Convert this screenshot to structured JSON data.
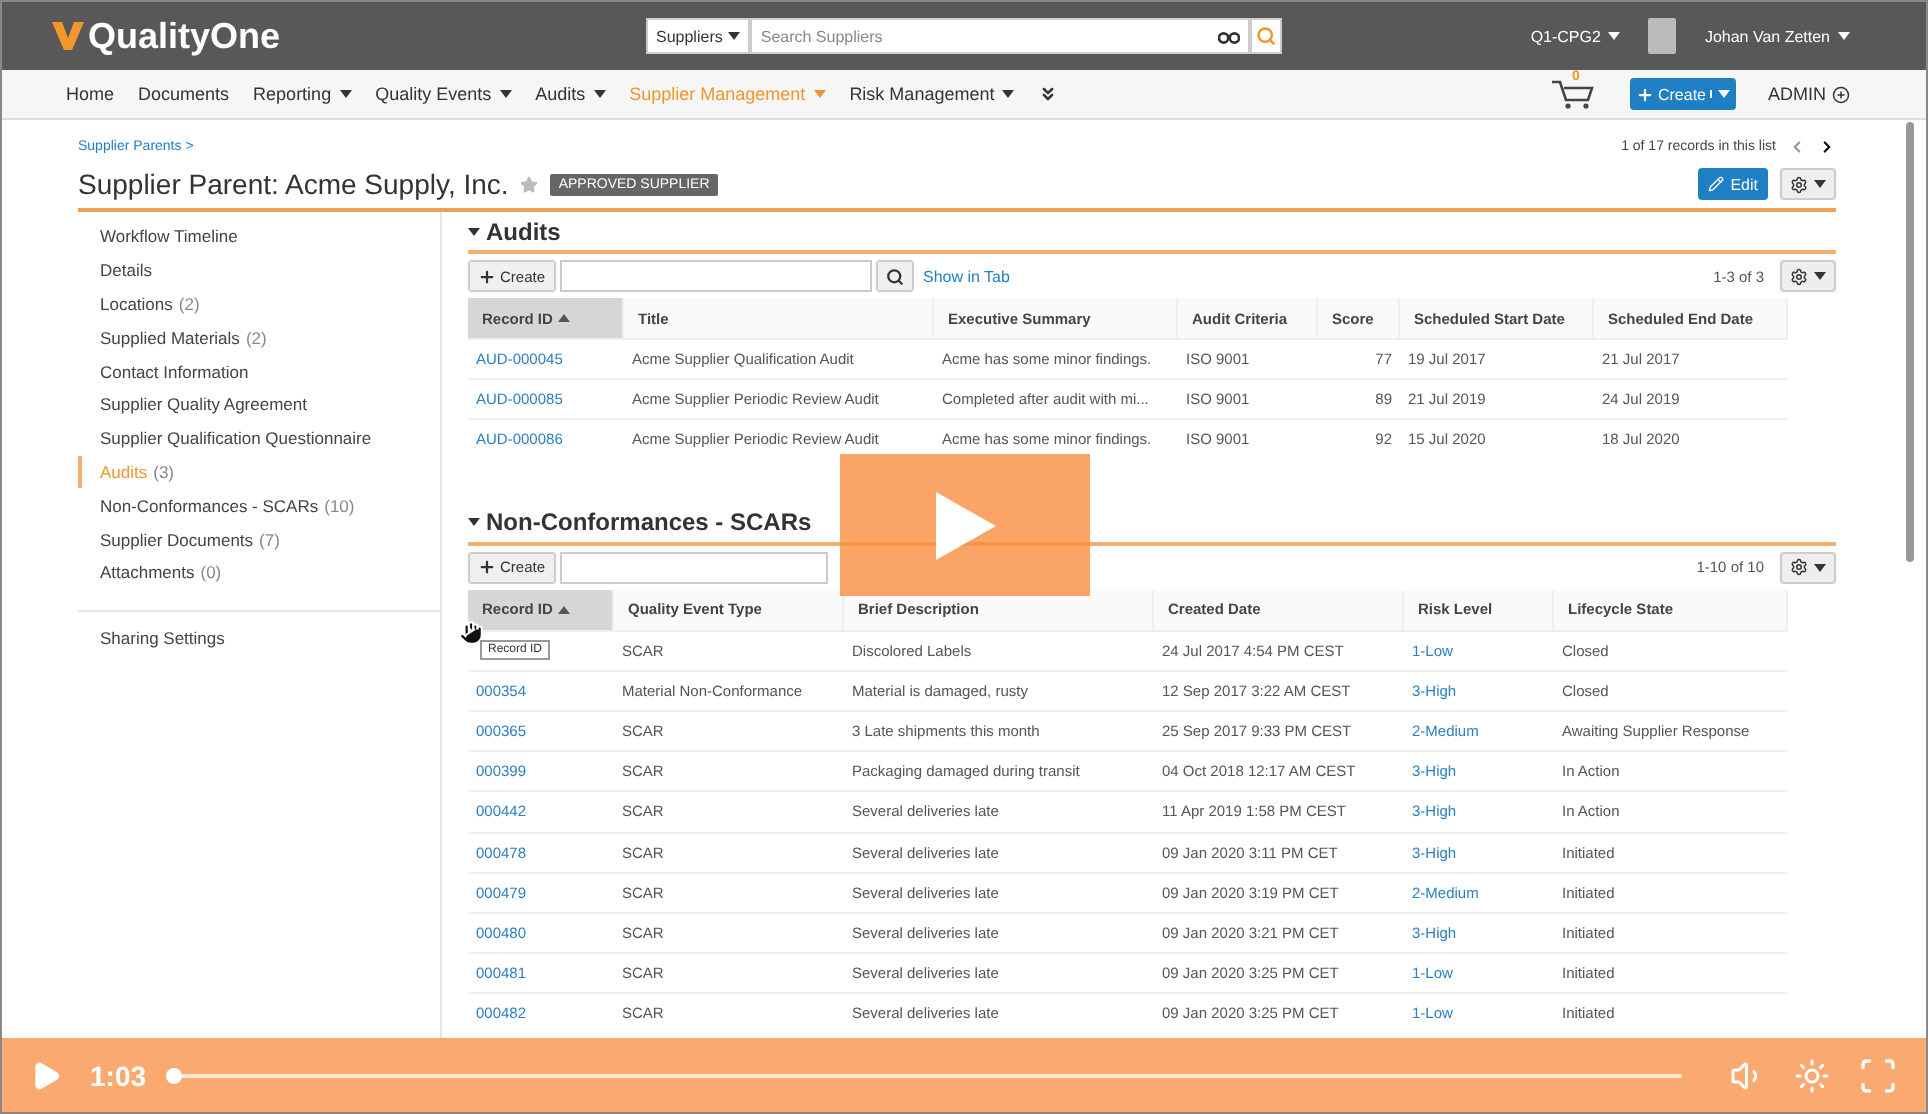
{
  "header": {
    "logo": "QualityOne",
    "search_scope": "Suppliers",
    "search": {
      "placeholder": "Search Suppliers"
    },
    "vault": "Q1-CPG2",
    "user": "Johan Van Zetten"
  },
  "nav": {
    "items": [
      {
        "label": "Home",
        "dropdown": false,
        "selected": false
      },
      {
        "label": "Documents",
        "dropdown": false,
        "selected": false
      },
      {
        "label": "Reporting",
        "dropdown": true,
        "selected": false
      },
      {
        "label": "Quality Events",
        "dropdown": true,
        "selected": false
      },
      {
        "label": "Audits",
        "dropdown": true,
        "selected": false
      },
      {
        "label": "Supplier Management",
        "dropdown": true,
        "selected": true
      },
      {
        "label": "Risk Management",
        "dropdown": true,
        "selected": false
      }
    ],
    "cart_count": "0",
    "create_button": "Create",
    "admin": "ADMIN"
  },
  "breadcrumb": "Supplier Parents >",
  "record_nav": "1 of 17 records in this list",
  "title": "Supplier Parent: Acme Supply, Inc.",
  "badge": "APPROVED SUPPLIER",
  "edit_button": "Edit",
  "sidebar": {
    "items": [
      {
        "label": "Workflow Timeline",
        "selected": false
      },
      {
        "label": "Details",
        "selected": false
      },
      {
        "label": "Locations",
        "count": "(2)",
        "selected": false
      },
      {
        "label": "Supplied Materials",
        "count": "(2)",
        "selected": false
      },
      {
        "label": "Contact Information",
        "selected": false
      },
      {
        "label": "Supplier Quality Agreement",
        "selected": false
      },
      {
        "label": "Supplier Qualification Questionnaire",
        "selected": false
      },
      {
        "label": "Audits",
        "count": "(3)",
        "selected": true
      },
      {
        "label": "Non-Conformances - SCARs",
        "count": "(10)",
        "selected": false
      },
      {
        "label": "Supplier Documents",
        "count": "(7)",
        "selected": false
      },
      {
        "label": "Attachments",
        "count": "(0)",
        "selected": false
      }
    ],
    "footer": "Sharing Settings"
  },
  "sections": [
    {
      "title": "Audits",
      "create_button": "Create",
      "show_in_tab": "Show in Tab",
      "range": "1-3 of 3",
      "columns": [
        {
          "label": "Record ID",
          "kind": "link",
          "sorted": true
        },
        {
          "label": "Title",
          "kind": "text",
          "sorted": false
        },
        {
          "label": "Executive Summary",
          "kind": "text",
          "sorted": false
        },
        {
          "label": "Audit Criteria",
          "kind": "text",
          "sorted": false
        },
        {
          "label": "Score",
          "kind": "number",
          "sorted": false
        },
        {
          "label": "Scheduled Start Date",
          "kind": "text",
          "sorted": false
        },
        {
          "label": "Scheduled End Date",
          "kind": "text",
          "sorted": false
        }
      ],
      "rows": [
        [
          "AUD-000045",
          "Acme Supplier Qualification Audit",
          "Acme has some minor findings.",
          "ISO 9001",
          "77",
          "19 Jul 2017",
          "21 Jul 2017"
        ],
        [
          "AUD-000085",
          "Acme Supplier Periodic Review Audit",
          "Completed after audit with mi...",
          "ISO 9001",
          "89",
          "21 Jul 2019",
          "24 Jul 2019"
        ],
        [
          "AUD-000086",
          "Acme Supplier Periodic Review Audit",
          "Acme has some minor findings.",
          "ISO 9001",
          "92",
          "15 Jul 2020",
          "18 Jul 2020"
        ]
      ]
    },
    {
      "title": "Non-Conformances - SCARs",
      "create_button": "Create",
      "range": "1-10 of 10",
      "columns": [
        {
          "label": "Record ID",
          "kind": "link",
          "sorted": true
        },
        {
          "label": "Quality Event Type",
          "kind": "text",
          "sorted": false
        },
        {
          "label": "Brief Description",
          "kind": "text",
          "sorted": false
        },
        {
          "label": "Created Date",
          "kind": "text",
          "sorted": false
        },
        {
          "label": "Risk Level",
          "kind": "link",
          "sorted": false
        },
        {
          "label": "Lifecycle State",
          "kind": "text",
          "sorted": false
        }
      ],
      "rows": [
        [
          null,
          "SCAR",
          "Discolored Labels",
          "24 Jul 2017 4:54 PM CEST",
          "1-Low",
          "Closed"
        ],
        [
          "000354",
          "Material Non-Conformance",
          "Material is damaged, rusty",
          "12 Sep 2017 3:22 AM CEST",
          "3-High",
          "Closed"
        ],
        [
          "000365",
          "SCAR",
          "3 Late shipments this month",
          "25 Sep 2017 9:33 PM CEST",
          "2-Medium",
          "Awaiting Supplier Response"
        ],
        [
          "000399",
          "SCAR",
          "Packaging damaged during transit",
          "04 Oct 2018 12:17 AM CEST",
          "3-High",
          "In Action"
        ],
        [
          "000442",
          "SCAR",
          "Several deliveries late",
          "11 Apr 2019 1:58 PM CEST",
          "3-High",
          "In Action"
        ],
        [
          "000478",
          "SCAR",
          "Several deliveries late",
          "09 Jan 2020 3:11 PM CET",
          "3-High",
          "Initiated"
        ],
        [
          "000479",
          "SCAR",
          "Several deliveries late",
          "09 Jan 2020 3:19 PM CET",
          "2-Medium",
          "Initiated"
        ],
        [
          "000480",
          "SCAR",
          "Several deliveries late",
          "09 Jan 2020 3:21 PM CET",
          "3-High",
          "Initiated"
        ],
        [
          "000481",
          "SCAR",
          "Several deliveries late",
          "09 Jan 2020 3:25 PM CET",
          "1-Low",
          "Initiated"
        ],
        [
          "000482",
          "SCAR",
          "Several deliveries late",
          "09 Jan 2020 3:25 PM CET",
          "1-Low",
          "Initiated"
        ]
      ]
    }
  ],
  "tooltip": "Record ID",
  "video": {
    "time": "1:03",
    "level": 0
  }
}
